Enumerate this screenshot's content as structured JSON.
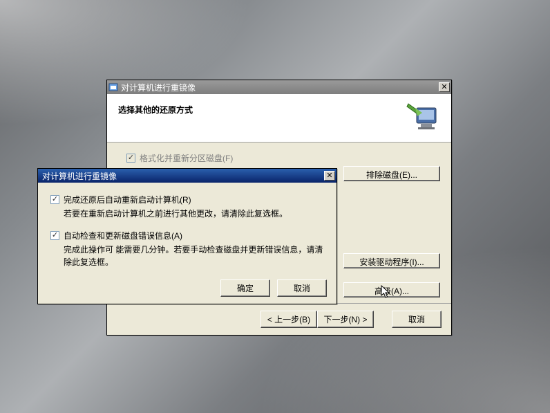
{
  "wizard": {
    "title": "对计算机进行重镜像",
    "header_title": "选择其他的还原方式",
    "format_checkbox_label": "格式化并重新分区磁盘(F)",
    "btn_exclude": "排除磁盘(E)...",
    "btn_install_driver": "安装驱动程序(I)...",
    "btn_advanced": "高级(A)...",
    "btn_back": "< 上一步(B)",
    "btn_next": "下一步(N) >",
    "btn_cancel": "取消"
  },
  "advanced": {
    "title": "对计算机进行重镜像",
    "check1_label": "完成还原后自动重新启动计算机(R)",
    "check1_desc": "若要在重新启动计算机之前进行其他更改，请清除此复选框。",
    "check2_label": "自动检查和更新磁盘错误信息(A)",
    "check2_desc": "完成此操作可 能需要几分钟。若要手动检查磁盘并更新错误信息，请清除此复选框。",
    "btn_ok": "确定",
    "btn_cancel": "取消"
  }
}
